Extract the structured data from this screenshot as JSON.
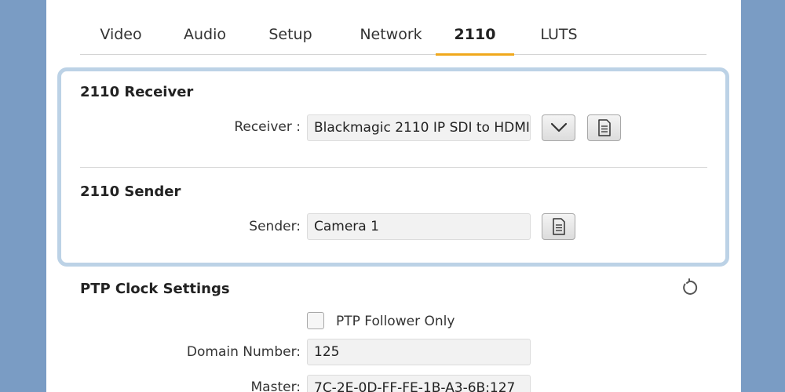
{
  "tabs": [
    {
      "label": "Video",
      "active": false
    },
    {
      "label": "Audio",
      "active": false
    },
    {
      "label": "Setup",
      "active": false
    },
    {
      "label": "Network",
      "active": false
    },
    {
      "label": "2110",
      "active": true
    },
    {
      "label": "LUTS",
      "active": false
    }
  ],
  "receiver_section": {
    "title": "2110 Receiver",
    "label": "Receiver :",
    "value": "Blackmagic 2110 IP SDI to HDMI...."
  },
  "sender_section": {
    "title": "2110 Sender",
    "label": "Sender:",
    "value": "Camera 1"
  },
  "ptp_section": {
    "title": "PTP Clock Settings",
    "follower_only_label": "PTP Follower Only",
    "follower_only_checked": false,
    "domain_label": "Domain Number:",
    "domain_value": "125",
    "master_label": "Master:",
    "master_value": "7C-2E-0D-FF-FE-1B-A3-6B:127"
  },
  "colors": {
    "background": "#7a9cc4",
    "accent": "#f0a81c",
    "card_border": "#bcd2e6"
  }
}
